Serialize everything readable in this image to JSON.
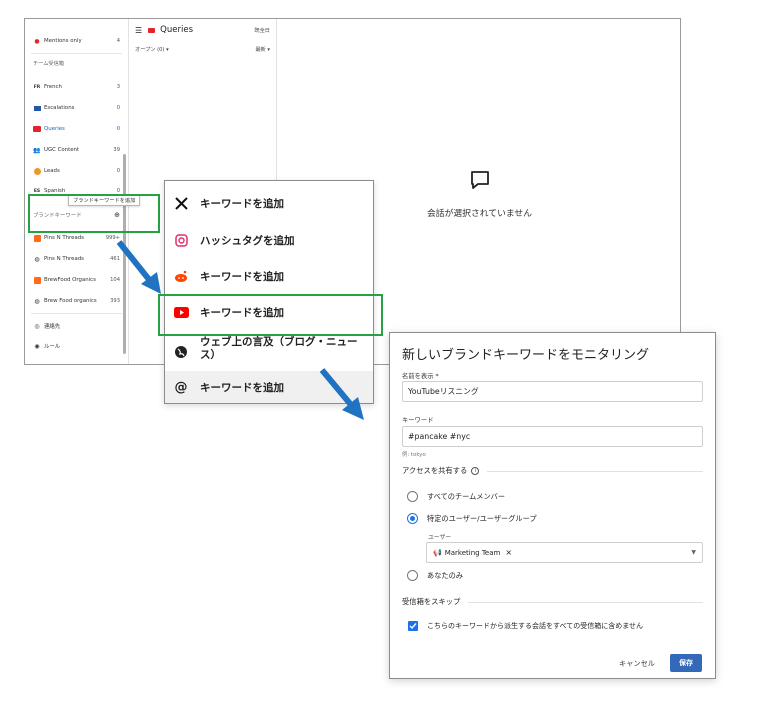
{
  "sidebar": {
    "top_item": {
      "label": "Mentions only",
      "count": "4"
    },
    "team_heading": "チーム受信箱",
    "team_items": [
      {
        "label": "French",
        "count": "3",
        "icon": "fr-badge"
      },
      {
        "label": "Escalations",
        "count": "0",
        "icon": "folder-icon"
      },
      {
        "label": "Queries",
        "count": "0",
        "icon": "queries-icon",
        "active": true
      },
      {
        "label": "UGC Content",
        "count": "39",
        "icon": "people-icon"
      },
      {
        "label": "Leads",
        "count": "0",
        "icon": "leads-icon"
      },
      {
        "label": "Spanish",
        "count": "0",
        "icon": "es-badge"
      }
    ],
    "brand_heading": "ブランドキーワード",
    "brand_tooltip": "ブランドキーワードを追加",
    "brand_items": [
      {
        "label": "Pins N Threads",
        "count": "999+",
        "icon": "reddit-badge"
      },
      {
        "label": "Pins N Threads",
        "count": "461",
        "icon": "web-icon"
      },
      {
        "label": "BrewFood Organics",
        "count": "104",
        "icon": "reddit-badge"
      },
      {
        "label": "Brew Food organics",
        "count": "393",
        "icon": "web-icon"
      }
    ],
    "contacts": "連絡先",
    "rules": "ルール"
  },
  "inbox": {
    "title": "Queries",
    "mark_all": "既全日",
    "filter_open": "オープン (0)",
    "filter_sort": "最新"
  },
  "empty_state": {
    "text": "会話が選択されていません"
  },
  "menu": {
    "items": [
      {
        "icon": "x-logo-icon",
        "label": "キーワードを追加"
      },
      {
        "icon": "instagram-icon",
        "label": "ハッシュタグを追加"
      },
      {
        "icon": "reddit-icon",
        "label": "キーワードを追加"
      },
      {
        "icon": "youtube-icon",
        "label": "キーワードを追加"
      },
      {
        "icon": "web-icon",
        "label": "ウェブ上の言及（ブログ・ニュース）"
      },
      {
        "icon": "threads-icon",
        "label": "キーワードを追加"
      }
    ]
  },
  "dialog": {
    "title": "新しいブランドキーワードをモニタリング",
    "name_label": "名前を表示 *",
    "name_value": "YouTubeリスニング",
    "keyword_label": "キーワード",
    "keyword_value": "#pancake #nyc",
    "keyword_hint": "例: tokyo",
    "access_heading": "アクセスを共有する",
    "access_options": [
      {
        "label": "すべてのチームメンバー",
        "selected": false
      },
      {
        "label": "特定のユーザー/ユーザーグループ",
        "selected": true
      },
      {
        "label": "あなたのみ",
        "selected": false
      }
    ],
    "user_label": "ユーザー",
    "user_chip": "Marketing Team",
    "skip_heading": "受信箱をスキップ",
    "skip_checkbox": "こちらのキーワードから派生する会話をすべての受信箱に含めません",
    "cancel": "キャンセル",
    "save": "保存"
  },
  "colors": {
    "accent_blue": "#1565c0",
    "primary_button": "#3468b9",
    "highlight_green": "#25a244",
    "arrow_blue": "#1f73c2",
    "youtube_red": "#e3242b"
  }
}
